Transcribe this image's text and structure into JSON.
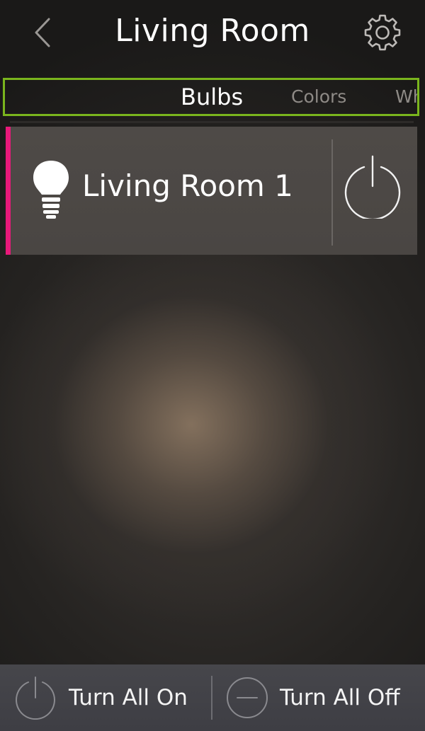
{
  "header": {
    "title": "Living Room",
    "back_icon": "chevron-left-icon",
    "settings_icon": "gear-icon"
  },
  "tabs": [
    {
      "label": "Bulbs",
      "active": true
    },
    {
      "label": "Colors",
      "active": false
    },
    {
      "label": "Wh",
      "active": false
    }
  ],
  "bulbs": [
    {
      "name": "Living Room 1",
      "icon": "bulb-icon",
      "power_icon": "power-icon",
      "accent_color": "#e8197a"
    }
  ],
  "footer": {
    "turn_all_on_label": "Turn All On",
    "turn_all_off_label": "Turn All Off",
    "on_icon": "power-icon",
    "off_icon": "minus-circle-icon"
  },
  "colors": {
    "tab_highlight": "#7ab51d",
    "active_text": "#ffffff",
    "inactive_text": "#8e8a86"
  }
}
